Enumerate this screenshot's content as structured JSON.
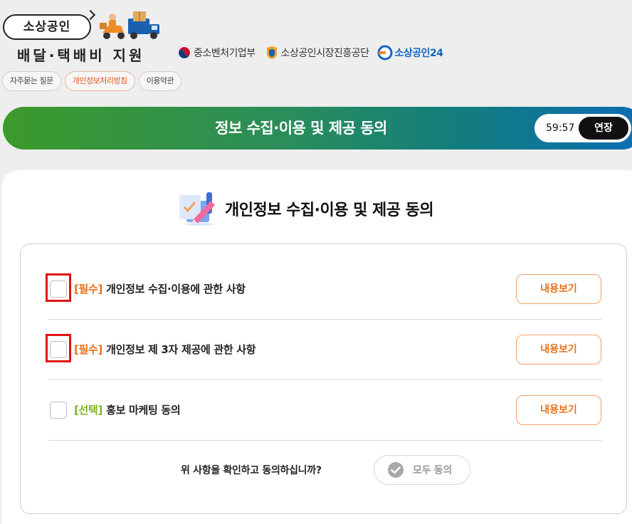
{
  "header": {
    "logo": {
      "line1": "소상공인",
      "line2": "배달·택배비 지원"
    },
    "partners": [
      {
        "name": "중소벤처기업부",
        "icon": "korea-emblem-icon"
      },
      {
        "name": "소상공인시장진흥공단",
        "icon": "semas-logo-icon"
      },
      {
        "name": "소상공인24",
        "icon": "sbiz24-logo-icon"
      }
    ],
    "quick_links": [
      {
        "label": "자주묻는 질문"
      },
      {
        "label": "개인정보처리방침"
      },
      {
        "label": "이용약관"
      }
    ]
  },
  "title_bar": {
    "title": "정보 수집·이용 및 제공 동의",
    "timer": "59:57",
    "extend_label": "연장"
  },
  "card": {
    "title": "개인정보 수집·이용 및 제공 동의",
    "items": [
      {
        "tag": "[필수]",
        "label": "개인정보 수집·이용에 관한 사항",
        "checked": false,
        "view_label": "내용보기"
      },
      {
        "tag": "[필수]",
        "label": "개인정보 제 3자 제공에 관한 사항",
        "checked": false,
        "view_label": "내용보기"
      },
      {
        "tag": "[선택]",
        "label": "홍보 마케팅 동의",
        "checked": false,
        "view_label": "내용보기"
      }
    ],
    "confirm_text": "위 사항을 확인하고 동의하십니까?",
    "agree_all_label": "모두 동의"
  },
  "colors": {
    "required_tag": "#e8701b",
    "optional_tag": "#7cb521",
    "highlight_frame": "#e01414",
    "gradient_start": "#3c9a2a",
    "gradient_end": "#0b6db3"
  }
}
